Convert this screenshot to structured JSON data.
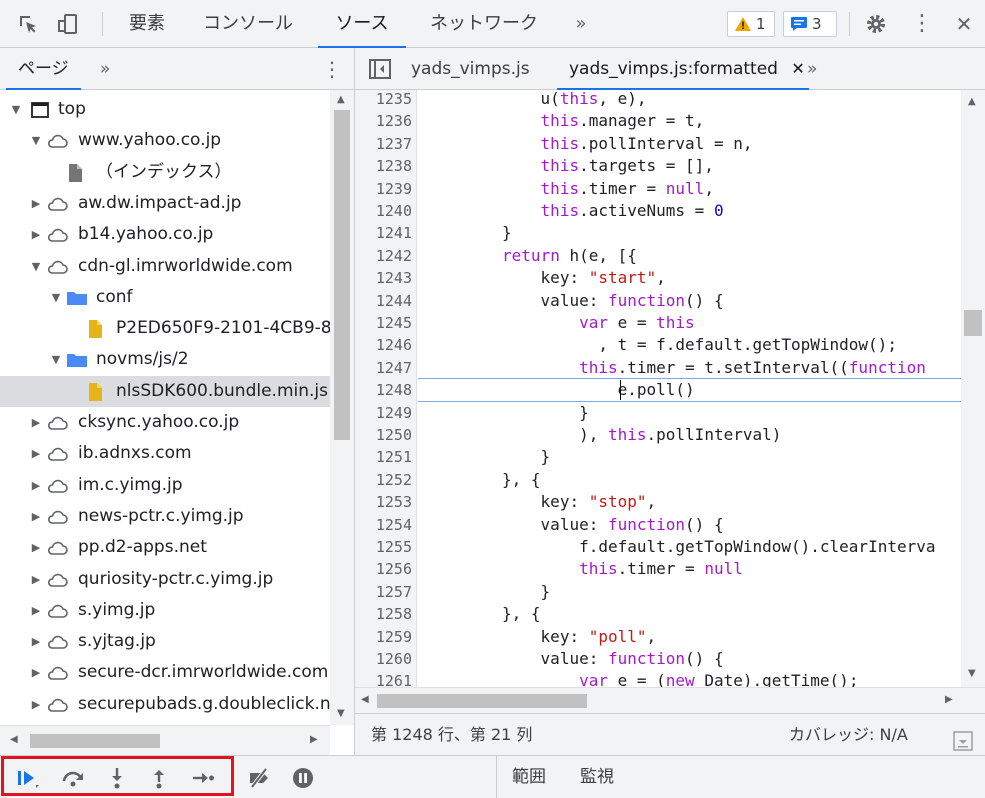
{
  "toolbar": {
    "tabs": [
      {
        "label": "要素"
      },
      {
        "label": "コンソール"
      },
      {
        "label": "ソース"
      },
      {
        "label": "ネットワーク"
      }
    ],
    "more_tabs": "»",
    "warnings_count": "1",
    "messages_count": "3",
    "close": "✕",
    "kebab": "⋮"
  },
  "left_panel": {
    "tab_label": "ページ",
    "more": "»",
    "kebab": "⋮",
    "tree": [
      {
        "label": "top",
        "level": 0,
        "icon": "frame-icon",
        "expanded": true
      },
      {
        "label": "www.yahoo.co.jp",
        "level": 1,
        "icon": "cloud-icon",
        "expanded": true
      },
      {
        "label": "（インデックス）",
        "level": 2,
        "icon": "file-gray-icon"
      },
      {
        "label": "aw.dw.impact-ad.jp",
        "level": 1,
        "icon": "cloud-icon",
        "expanded": false
      },
      {
        "label": "b14.yahoo.co.jp",
        "level": 1,
        "icon": "cloud-icon",
        "expanded": false
      },
      {
        "label": "cdn-gl.imrworldwide.com",
        "level": 1,
        "icon": "cloud-icon",
        "expanded": true
      },
      {
        "label": "conf",
        "level": 2,
        "icon": "folder-icon",
        "expanded": true
      },
      {
        "label": "P2ED650F9-2101-4CB9-8",
        "level": 3,
        "icon": "file-yellow-icon"
      },
      {
        "label": "novms/js/2",
        "level": 2,
        "icon": "folder-icon",
        "expanded": true
      },
      {
        "label": "nlsSDK600.bundle.min.js",
        "level": 3,
        "icon": "file-yellow-icon",
        "selected": true
      },
      {
        "label": "cksync.yahoo.co.jp",
        "level": 1,
        "icon": "cloud-icon",
        "expanded": false
      },
      {
        "label": "ib.adnxs.com",
        "level": 1,
        "icon": "cloud-icon",
        "expanded": false
      },
      {
        "label": "im.c.yimg.jp",
        "level": 1,
        "icon": "cloud-icon",
        "expanded": false
      },
      {
        "label": "news-pctr.c.yimg.jp",
        "level": 1,
        "icon": "cloud-icon",
        "expanded": false
      },
      {
        "label": "pp.d2-apps.net",
        "level": 1,
        "icon": "cloud-icon",
        "expanded": false
      },
      {
        "label": "quriosity-pctr.c.yimg.jp",
        "level": 1,
        "icon": "cloud-icon",
        "expanded": false
      },
      {
        "label": "s.yimg.jp",
        "level": 1,
        "icon": "cloud-icon",
        "expanded": false
      },
      {
        "label": "s.yjtag.jp",
        "level": 1,
        "icon": "cloud-icon",
        "expanded": false
      },
      {
        "label": "secure-dcr.imrworldwide.com",
        "level": 1,
        "icon": "cloud-icon",
        "expanded": false
      },
      {
        "label": "securepubads.g.doubleclick.ne",
        "level": 1,
        "icon": "cloud-icon",
        "expanded": false
      }
    ]
  },
  "editor": {
    "tabs": [
      {
        "label": "yads_vimps.js"
      },
      {
        "label": "yads_vimps.js:formatted",
        "close": "✕"
      }
    ],
    "more": "»",
    "current_line": "1248",
    "lines": [
      {
        "n": "1235",
        "indent": 12,
        "parts": [
          [
            "u(",
            ""
          ],
          [
            "this",
            "kw"
          ],
          [
            ", e),",
            ""
          ]
        ]
      },
      {
        "n": "1236",
        "indent": 12,
        "parts": [
          [
            "this",
            "kw"
          ],
          [
            ".manager = t,",
            ""
          ]
        ]
      },
      {
        "n": "1237",
        "indent": 12,
        "parts": [
          [
            "this",
            "kw"
          ],
          [
            ".pollInterval = n,",
            ""
          ]
        ]
      },
      {
        "n": "1238",
        "indent": 12,
        "parts": [
          [
            "this",
            "kw"
          ],
          [
            ".targets = [],",
            ""
          ]
        ]
      },
      {
        "n": "1239",
        "indent": 12,
        "parts": [
          [
            "this",
            "kw"
          ],
          [
            ".timer = ",
            ""
          ],
          [
            "null",
            "kw"
          ],
          [
            ",",
            ""
          ]
        ]
      },
      {
        "n": "1240",
        "indent": 12,
        "parts": [
          [
            "this",
            "kw"
          ],
          [
            ".activeNums = ",
            ""
          ],
          [
            "0",
            "num"
          ]
        ]
      },
      {
        "n": "1241",
        "indent": 8,
        "parts": [
          [
            "}",
            ""
          ]
        ]
      },
      {
        "n": "1242",
        "indent": 8,
        "parts": [
          [
            "return",
            "kw"
          ],
          [
            " h(e, [{",
            ""
          ]
        ]
      },
      {
        "n": "1243",
        "indent": 12,
        "parts": [
          [
            "key: ",
            ""
          ],
          [
            "\"start\"",
            "str"
          ],
          [
            ",",
            ""
          ]
        ]
      },
      {
        "n": "1244",
        "indent": 12,
        "parts": [
          [
            "value: ",
            ""
          ],
          [
            "function",
            "kw"
          ],
          [
            "() {",
            ""
          ]
        ]
      },
      {
        "n": "1245",
        "indent": 16,
        "parts": [
          [
            "var",
            "kw"
          ],
          [
            " e = ",
            ""
          ],
          [
            "this",
            "kw"
          ]
        ]
      },
      {
        "n": "1246",
        "indent": 18,
        "parts": [
          [
            ", t = f.default.getTopWindow();",
            ""
          ]
        ]
      },
      {
        "n": "1247",
        "indent": 16,
        "parts": [
          [
            "this",
            "kw"
          ],
          [
            ".timer = t.setInterval((",
            ""
          ],
          [
            "function",
            "kw"
          ]
        ]
      },
      {
        "n": "1248",
        "indent": 20,
        "parts": [
          [
            "e.poll()",
            ""
          ]
        ]
      },
      {
        "n": "1249",
        "indent": 16,
        "parts": [
          [
            "}",
            ""
          ]
        ]
      },
      {
        "n": "1250",
        "indent": 16,
        "parts": [
          [
            "), ",
            ""
          ],
          [
            "this",
            "kw"
          ],
          [
            ".pollInterval)",
            ""
          ]
        ]
      },
      {
        "n": "1251",
        "indent": 12,
        "parts": [
          [
            "}",
            ""
          ]
        ]
      },
      {
        "n": "1252",
        "indent": 8,
        "parts": [
          [
            "}, {",
            ""
          ]
        ]
      },
      {
        "n": "1253",
        "indent": 12,
        "parts": [
          [
            "key: ",
            ""
          ],
          [
            "\"stop\"",
            "str"
          ],
          [
            ",",
            ""
          ]
        ]
      },
      {
        "n": "1254",
        "indent": 12,
        "parts": [
          [
            "value: ",
            ""
          ],
          [
            "function",
            "kw"
          ],
          [
            "() {",
            ""
          ]
        ]
      },
      {
        "n": "1255",
        "indent": 16,
        "parts": [
          [
            "f.default.getTopWindow().clearInterva",
            ""
          ]
        ]
      },
      {
        "n": "1256",
        "indent": 16,
        "parts": [
          [
            "this",
            "kw"
          ],
          [
            ".timer = ",
            ""
          ],
          [
            "null",
            "kw"
          ]
        ]
      },
      {
        "n": "1257",
        "indent": 12,
        "parts": [
          [
            "}",
            ""
          ]
        ]
      },
      {
        "n": "1258",
        "indent": 8,
        "parts": [
          [
            "}, {",
            ""
          ]
        ]
      },
      {
        "n": "1259",
        "indent": 12,
        "parts": [
          [
            "key: ",
            ""
          ],
          [
            "\"poll\"",
            "str"
          ],
          [
            ",",
            ""
          ]
        ]
      },
      {
        "n": "1260",
        "indent": 12,
        "parts": [
          [
            "value: ",
            ""
          ],
          [
            "function",
            "kw"
          ],
          [
            "() {",
            ""
          ]
        ]
      },
      {
        "n": "1261",
        "indent": 16,
        "parts": [
          [
            "var",
            "kw"
          ],
          [
            " e = (",
            ""
          ],
          [
            "new",
            "kw"
          ],
          [
            " Date).getTime();",
            ""
          ]
        ]
      }
    ]
  },
  "status": {
    "position": "第 1248 行、第 21 列",
    "coverage": "カバレッジ: N/A"
  },
  "bottom": {
    "scope_tab": "範囲",
    "watch_tab": "監視"
  },
  "colors": {
    "accent": "#1a73e8",
    "highlight_box": "#e0141e",
    "keyword": "#a31acb",
    "string": "#c41a16",
    "number": "#1c00cf"
  }
}
